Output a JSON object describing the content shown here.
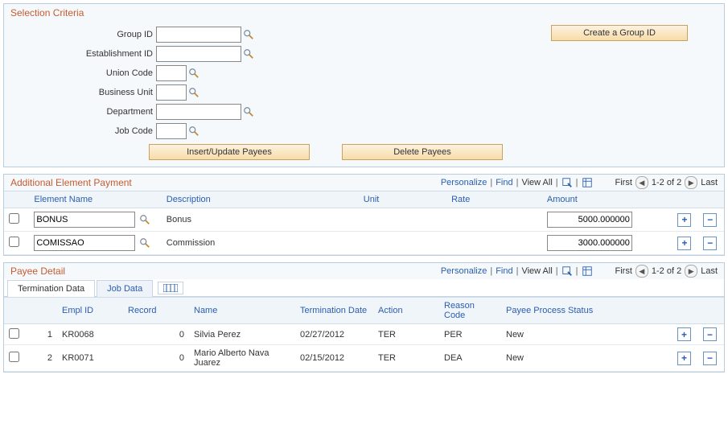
{
  "criteria": {
    "title": "Selection Criteria",
    "group_id_label": "Group ID",
    "establishment_label": "Establishment ID",
    "union_code_label": "Union Code",
    "business_unit_label": "Business Unit",
    "department_label": "Department",
    "job_code_label": "Job Code",
    "group_id_value": "",
    "establishment_value": "",
    "union_code_value": "",
    "business_unit_value": "",
    "department_value": "",
    "job_code_value": "",
    "create_group_label": "Create a Group ID",
    "insert_update_label": "Insert/Update Payees",
    "delete_payees_label": "Delete Payees"
  },
  "aep": {
    "title": "Additional Element Payment",
    "personalize": "Personalize",
    "find": "Find",
    "view_all": "View All",
    "first": "First",
    "last": "Last",
    "range": "1-2 of 2",
    "cols": {
      "element_name": "Element Name",
      "description": "Description",
      "unit": "Unit",
      "rate": "Rate",
      "amount": "Amount"
    },
    "rows": [
      {
        "element": "BONUS",
        "desc": "Bonus",
        "unit": "",
        "rate": "",
        "amount": "5000.000000"
      },
      {
        "element": "COMISSAO",
        "desc": "Commission",
        "unit": "",
        "rate": "",
        "amount": "3000.000000"
      }
    ]
  },
  "payee": {
    "title": "Payee Detail",
    "personalize": "Personalize",
    "find": "Find",
    "view_all": "View All",
    "first": "First",
    "last": "Last",
    "range": "1-2 of 2",
    "tabs": {
      "termination": "Termination Data",
      "job": "Job Data"
    },
    "cols": {
      "empl_id": "Empl ID",
      "record": "Record",
      "name": "Name",
      "term_date": "Termination Date",
      "action": "Action",
      "reason": "Reason Code",
      "status": "Payee Process Status"
    },
    "rows": [
      {
        "n": "1",
        "empl": "KR0068",
        "rec": "0",
        "name": "Silvia Perez",
        "date": "02/27/2012",
        "action": "TER",
        "reason": "PER",
        "status": "New"
      },
      {
        "n": "2",
        "empl": "KR0071",
        "rec": "0",
        "name": "Mario Alberto Nava Juarez",
        "date": "02/15/2012",
        "action": "TER",
        "reason": "DEA",
        "status": "New"
      }
    ]
  }
}
